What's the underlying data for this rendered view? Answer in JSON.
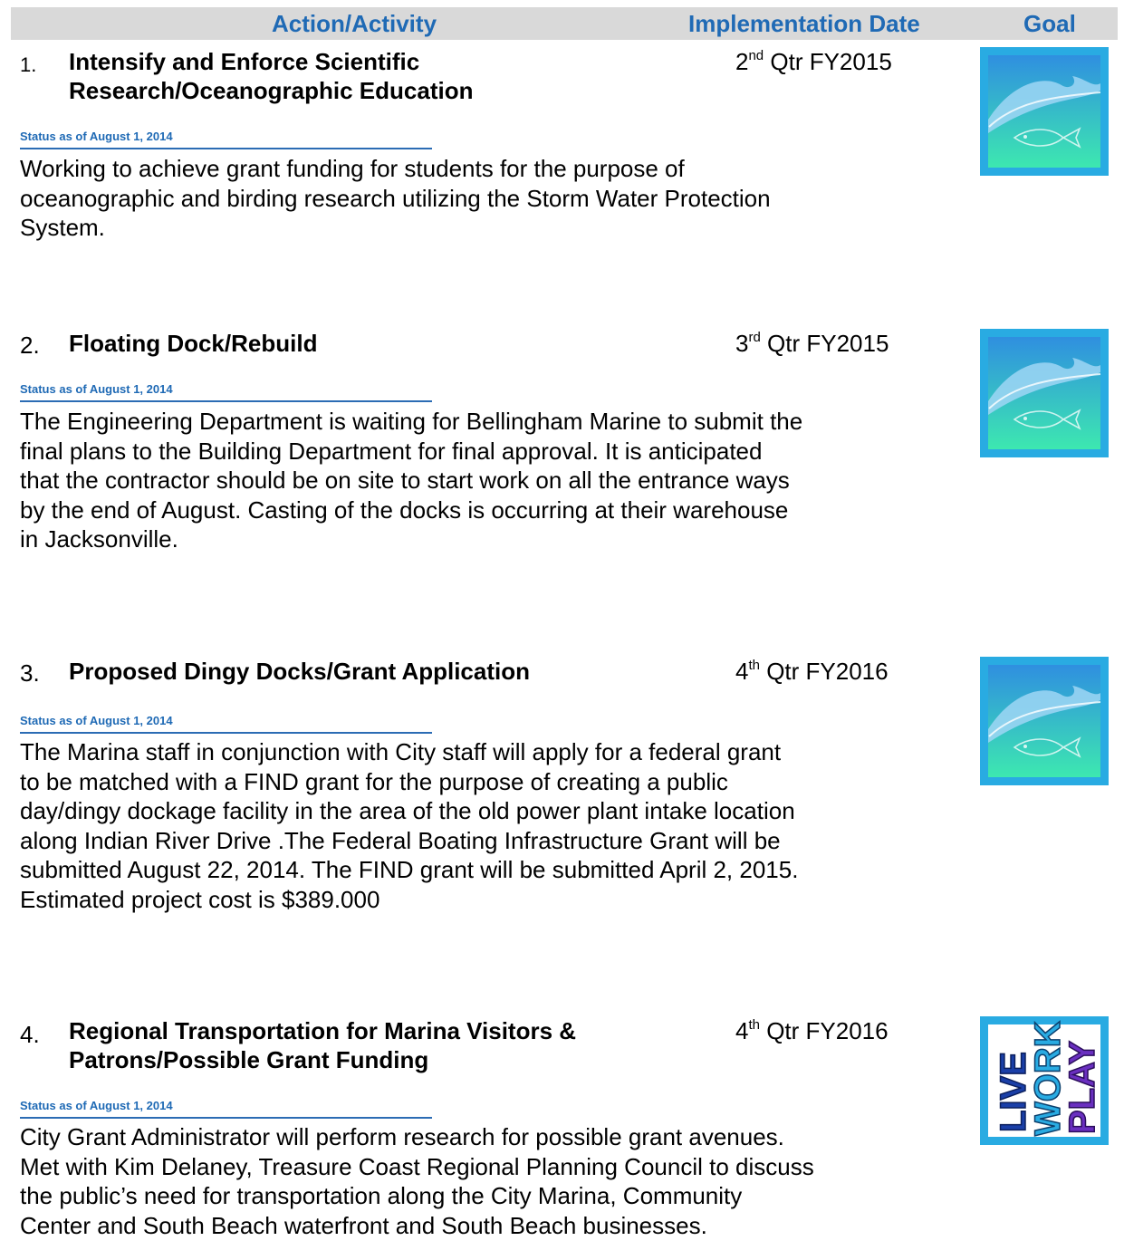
{
  "header": {
    "action": "Action/Activity",
    "date": "Implementation Date",
    "goal": "Goal"
  },
  "items": [
    {
      "number": "1.",
      "title_lines": [
        "Intensify and Enforce Scientific",
        "Research/Oceanographic Education"
      ],
      "date_num": "2",
      "date_sup": "nd",
      "date_rest": " Qtr FY2015",
      "status": "Status as of August 1, 2014",
      "body_lines": [
        "Working to achieve grant funding for students for the purpose of",
        "oceanographic and birding research utilizing the Storm Water Protection",
        "System."
      ],
      "goal_icon": "wave-fish-icon"
    },
    {
      "number": "2.",
      "title_lines": [
        "Floating Dock/Rebuild"
      ],
      "date_num": "3",
      "date_sup": "rd",
      "date_rest": " Qtr FY2015",
      "status": "Status as of August 1, 2014",
      "body_lines": [
        "The Engineering Department is waiting for Bellingham Marine to submit the",
        "final plans to the Building Department for final approval. It is anticipated",
        "that the contractor should be on site to start work on all the entrance ways",
        "by the end of August.  Casting of the docks is occurring at their warehouse",
        "in Jacksonville."
      ],
      "goal_icon": "wave-fish-icon"
    },
    {
      "number": "3.",
      "title_lines": [
        "Proposed Dingy Docks/Grant Application"
      ],
      "date_num": "4",
      "date_sup": "th",
      "date_rest": " Qtr FY2016",
      "status": "Status as of August 1, 2014",
      "body_lines": [
        "The Marina staff in conjunction with City staff will apply for a federal grant",
        "to be matched with a FIND grant for the purpose of creating a public",
        "day/dingy dockage facility in the area of the old power plant intake location",
        "along Indian River Drive .The Federal Boating Infrastructure Grant will be",
        "submitted August 22, 2014.  The FIND grant will be submitted April 2, 2015.",
        "Estimated project cost  is $389.000"
      ],
      "goal_icon": "wave-fish-icon"
    },
    {
      "number": "4.",
      "title_lines": [
        "Regional Transportation for Marina Visitors &",
        "Patrons/Possible Grant Funding"
      ],
      "date_num": "4",
      "date_sup": "th",
      "date_rest": " Qtr FY2016",
      "status": "Status as of August 1, 2014",
      "body_lines": [
        "City Grant Administrator will perform research for possible grant avenues.",
        "Met with Kim Delaney, Treasure Coast Regional Planning Council to discuss",
        "the public’s need for transportation along the City Marina, Community",
        "Center and South Beach waterfront and South Beach businesses."
      ],
      "goal_icon": "live-work-play-icon",
      "goal_icon_words": [
        "LIVE",
        "WORK",
        "PLAY"
      ]
    }
  ],
  "colors": {
    "header_text": "#1f6ab5",
    "header_bg": "#d9d9d9",
    "icon_frame": "#29abe2",
    "icon_gradient_top": "#2f8fe0",
    "icon_gradient_bottom": "#3de8b0"
  }
}
